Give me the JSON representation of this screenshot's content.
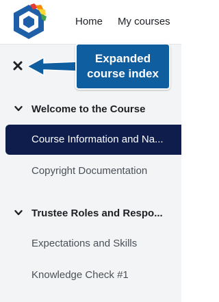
{
  "nav": {
    "home_label": "Home",
    "courses_label": "My courses"
  },
  "callout": {
    "line1": "Expanded",
    "line2": "course index"
  },
  "colors": {
    "accent": "#0f5ea0",
    "active_item_bg": "#0f1d4d",
    "drawer_bg": "#f3f4f5"
  },
  "course_index": {
    "close_icon": "close-icon",
    "sections": [
      {
        "title": "Welcome to the Course",
        "expanded": true,
        "items": [
          {
            "label": "Course Information and Na...",
            "active": true
          },
          {
            "label": "Copyright Documentation",
            "active": false
          }
        ]
      },
      {
        "title": "Trustee Roles and Respo...",
        "expanded": true,
        "items": [
          {
            "label": "Expectations and Skills",
            "active": false
          },
          {
            "label": "Knowledge Check #1",
            "active": false
          }
        ]
      }
    ]
  }
}
